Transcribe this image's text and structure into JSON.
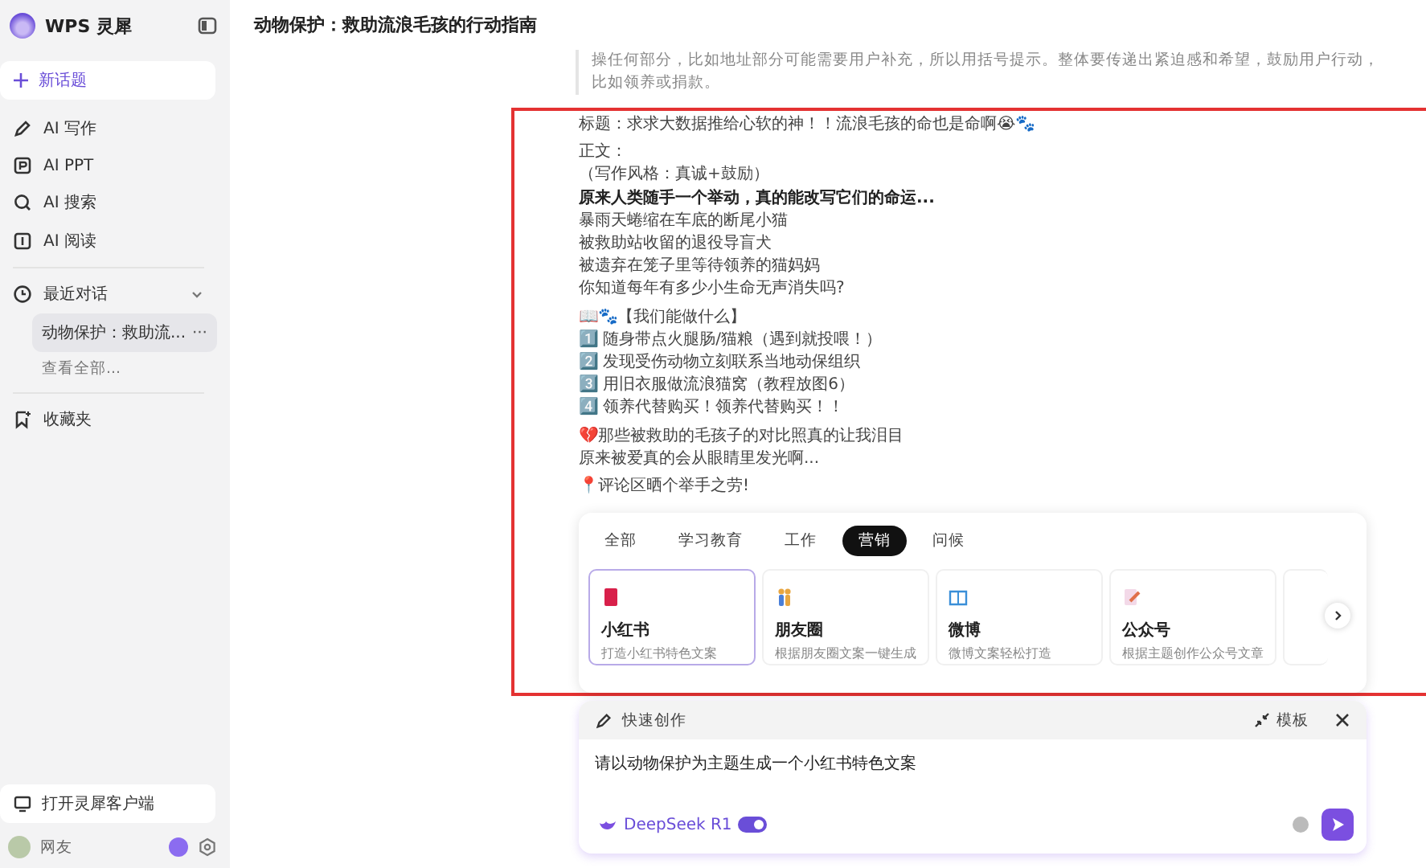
{
  "sidebar": {
    "app_name": "WPS 灵犀",
    "new_topic": "新话题",
    "nav_items": [
      {
        "label": "AI 写作",
        "selected": false
      },
      {
        "label": "AI PPT",
        "selected": false
      },
      {
        "label": "AI 搜索",
        "selected": false
      },
      {
        "label": "AI 阅读",
        "selected": false
      }
    ],
    "recent": {
      "label": "最近对话",
      "expanded": true,
      "items": [
        {
          "label": "动物保护：救助流...",
          "selected": true,
          "more": "···"
        }
      ],
      "view_all": "查看全部..."
    },
    "favorites": "收藏夹",
    "open_client": "打开灵犀客户端",
    "user_name": "网友"
  },
  "chat": {
    "title": "动物保护：救助流浪毛孩的行动指南",
    "quote": "操任何部分，比如地址部分可能需要用户补充，所以用括号提示。整体要传递出紧迫感和希望，鼓励用户行动，比如领养或捐款。",
    "paragraphs": [
      {
        "lines": [
          {
            "text": "标题：求求大数据推给心软的神！！流浪毛孩的命也是命啊😭🐾",
            "bold": false
          }
        ]
      },
      {
        "lines": [
          {
            "text": "正文：",
            "bold": false
          },
          {
            "text": "（写作风格：真诚+鼓励）",
            "bold": false
          },
          {
            "text": "原来人类随手一个举动，真的能改写它们的命运...",
            "bold": true
          },
          {
            "text": "暴雨天蜷缩在车底的断尾小猫",
            "bold": false
          },
          {
            "text": "被救助站收留的退役导盲犬",
            "bold": false
          },
          {
            "text": "被遗弃在笼子里等待领养的猫妈妈",
            "bold": false
          },
          {
            "text": "你知道每年有多少小生命无声消失吗?",
            "bold": false
          }
        ]
      },
      {
        "lines": [
          {
            "text": "📖🐾【我们能做什么】",
            "bold": false
          },
          {
            "text": "1️⃣ 随身带点火腿肠/猫粮（遇到就投喂！）",
            "bold": false
          },
          {
            "text": "2️⃣ 发现受伤动物立刻联系当地动保组织",
            "bold": false
          },
          {
            "text": "3️⃣ 用旧衣服做流浪猫窝（教程放图6）",
            "bold": false
          },
          {
            "text": "4️⃣ 领养代替购买！领养代替购买！！",
            "bold": false
          }
        ]
      },
      {
        "lines": [
          {
            "text": "💔那些被救助的毛孩子的对比照真的让我泪目",
            "bold": false
          },
          {
            "text": "原来被爱真的会从眼睛里发光啊...",
            "bold": false
          }
        ]
      },
      {
        "lines": [
          {
            "text": "📍评论区晒个举手之劳!",
            "bold": false
          }
        ]
      }
    ]
  },
  "templates": {
    "tabs": [
      {
        "label": "全部",
        "selected": false
      },
      {
        "label": "学习教育",
        "selected": false
      },
      {
        "label": "工作",
        "selected": false
      },
      {
        "label": "营销",
        "selected": true
      },
      {
        "label": "问候",
        "selected": false
      }
    ],
    "cards": [
      {
        "title": "小红书",
        "desc": "打造小红书特色文案",
        "selected": true
      },
      {
        "title": "朋友圈",
        "desc": "根据朋友圈文案一键生成",
        "selected": false
      },
      {
        "title": "微博",
        "desc": "微博文案轻松打造",
        "selected": false
      },
      {
        "title": "公众号",
        "desc": "根据主题创作公众号文章",
        "selected": false
      }
    ]
  },
  "quick_create": {
    "title": "快速创作",
    "template_button": "模板",
    "value": "请以动物保护为主题生成一个小红书特色文案",
    "model": "DeepSeek R1",
    "deep_think_on": true
  }
}
